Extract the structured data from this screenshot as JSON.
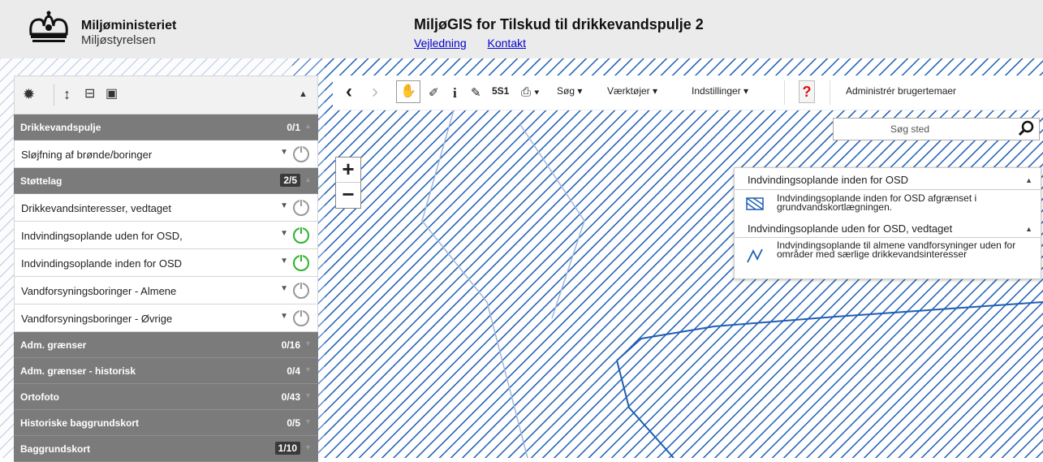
{
  "header": {
    "org_name": "Miljøministeriet",
    "org_sub": "Miljøstyrelsen",
    "title": "MiljøGIS for Tilskud til drikkevandspulje 2",
    "links": [
      "Vejledning",
      "Kontakt"
    ]
  },
  "toolbar": {
    "search_label": "Søg",
    "tools_label": "Værktøjer",
    "settings_label": "Indstillinger",
    "admin_label": "Administrér brugertemaer",
    "coord_label": "5S1"
  },
  "search": {
    "placeholder": "Søg sted"
  },
  "zoom": {
    "in": "+",
    "out": "−"
  },
  "panel": {
    "groups": [
      {
        "label": "Drikkevandspulje",
        "count": "0/1"
      },
      {
        "label": "Støttelag",
        "count": "2/5"
      },
      {
        "label": "Adm. grænser",
        "count": "0/16"
      },
      {
        "label": "Adm. grænser - historisk",
        "count": "0/4"
      },
      {
        "label": "Ortofoto",
        "count": "0/43"
      },
      {
        "label": "Historiske baggrundskort",
        "count": "0/5"
      },
      {
        "label": "Baggrundskort",
        "count": "1/10"
      }
    ],
    "layers": [
      {
        "label": "Sløjfning af brønde/boringer",
        "on": false
      },
      {
        "label": "Drikkevandsinteresser, vedtaget",
        "on": false
      },
      {
        "label": "Indvindingsoplande uden for OSD,",
        "on": true
      },
      {
        "label": "Indvindingsoplande inden for OSD",
        "on": true
      },
      {
        "label": "Vandforsyningsboringer - Almene",
        "on": false
      },
      {
        "label": "Vandforsyningsboringer - Øvrige",
        "on": false
      }
    ]
  },
  "legend": {
    "sections": [
      {
        "title": "Indvindingsoplande inden for OSD",
        "item": "Indvindingsoplande inden for OSD afgrænset i grundvandskortlægningen."
      },
      {
        "title": "Indvindingsoplande uden for OSD, vedtaget",
        "item": "Indvindingsoplande til almene vandforsyninger uden for områder med særlige drikkevandsinteresser"
      }
    ]
  },
  "colors": {
    "hatch": "#1f5fb4",
    "group_bg": "#7b7b7b",
    "power_on": "#2db32d"
  }
}
